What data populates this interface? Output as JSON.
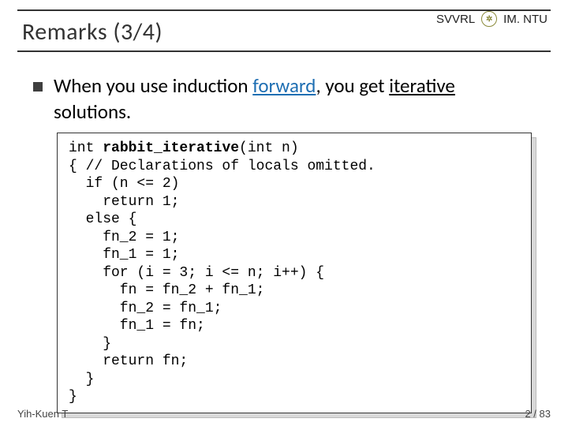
{
  "header": {
    "title": "Remarks (3/4)",
    "right_label_1": "SVVRL",
    "at": "@",
    "right_label_2": "IM. NTU",
    "logo_text": "✲"
  },
  "bullet": {
    "pre": "When you use induction ",
    "forward": "forward",
    "mid": ", you get ",
    "iterative": "iterative",
    "post": " solutions."
  },
  "code": {
    "l1a": "int ",
    "l1b": "rabbit_iterative",
    "l1c": "(int n)",
    "l2": "{ // Declarations of locals omitted.",
    "l3": "  if (n <= 2)",
    "l4": "    return 1;",
    "l5": "  else {",
    "l6": "    fn_2 = 1;",
    "l7": "    fn_1 = 1;",
    "l8": "    for (i = 3; i <= n; i++) {",
    "l9": "      fn = fn_2 + fn_1;",
    "l10": "      fn_2 = fn_1;",
    "l11": "      fn_1 = fn;",
    "l12": "    }",
    "l13": "    return fn;",
    "l14": "  }",
    "l15": "}"
  },
  "footer": {
    "left": "Yih-Kuen T",
    "right": "2 / 83"
  }
}
